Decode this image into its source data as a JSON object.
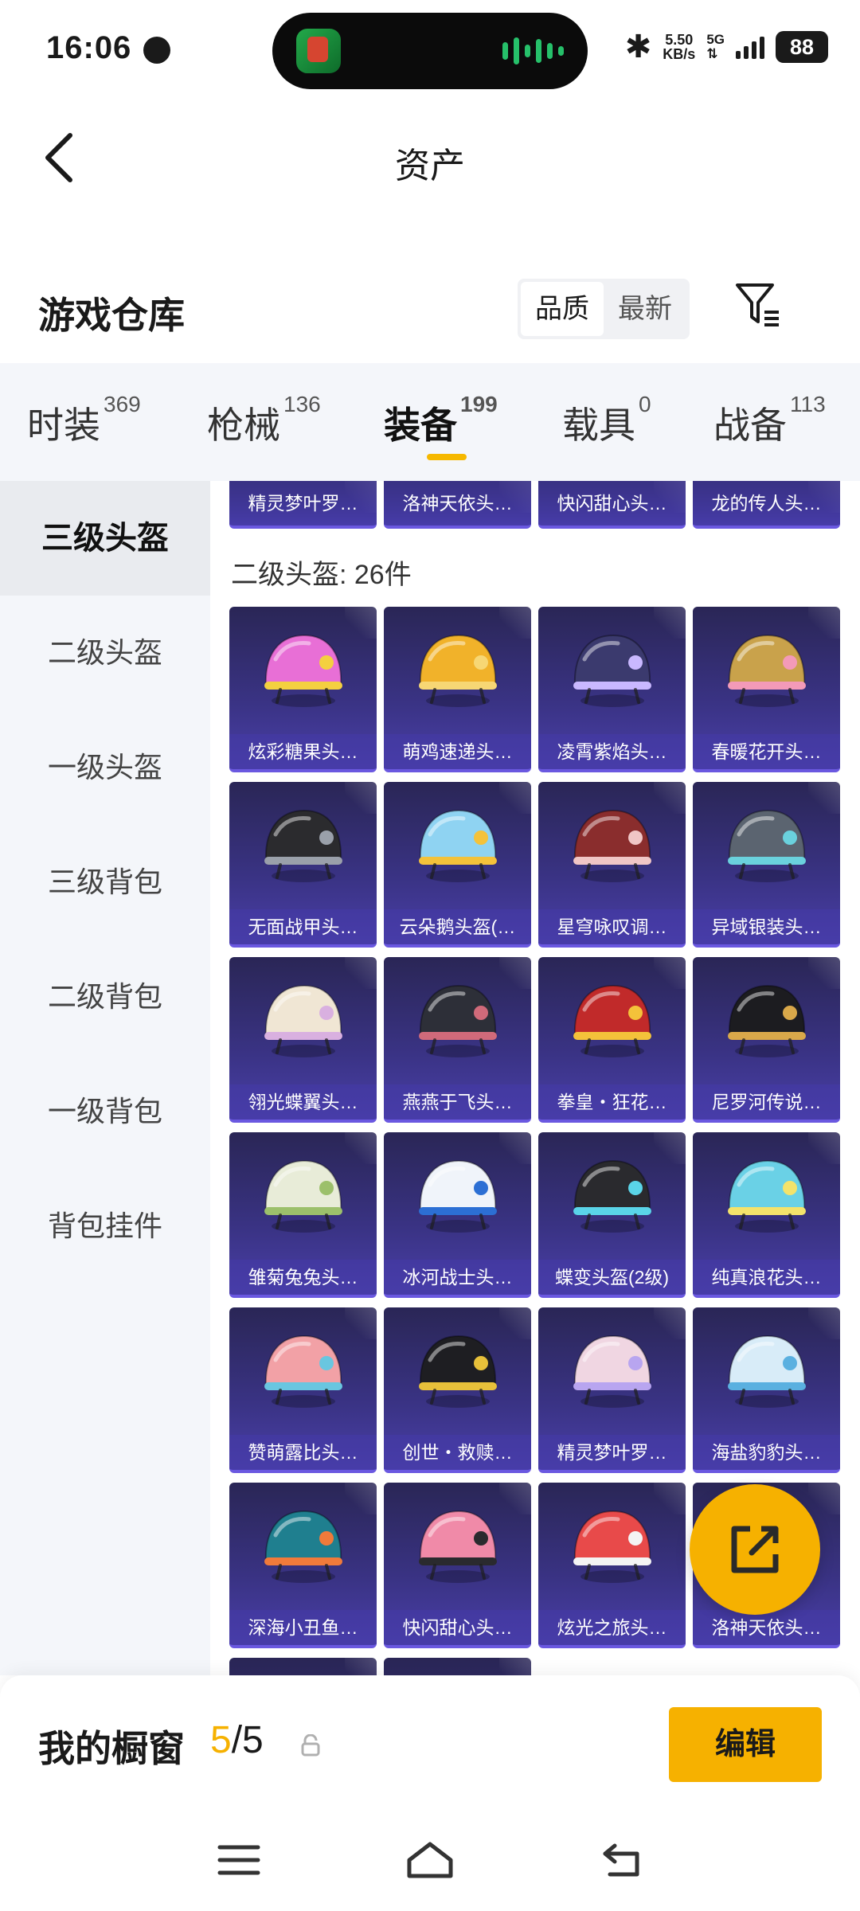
{
  "status_bar": {
    "time": "16:06",
    "net_speed": "5.50",
    "net_unit": "KB/s",
    "network": "5G",
    "battery": "88"
  },
  "header": {
    "title": "资产"
  },
  "section": {
    "title": "游戏仓库",
    "sort_options": [
      "品质",
      "最新"
    ],
    "sort_selected": "品质"
  },
  "tabs": [
    {
      "label": "时装",
      "count": "369"
    },
    {
      "label": "枪械",
      "count": "136"
    },
    {
      "label": "装备",
      "count": "199"
    },
    {
      "label": "载具",
      "count": "0"
    },
    {
      "label": "战备",
      "count": "113"
    }
  ],
  "active_tab": "装备",
  "sidebar": {
    "items": [
      "三级头盔",
      "二级头盔",
      "一级头盔",
      "三级背包",
      "二级背包",
      "一级背包",
      "背包挂件"
    ],
    "active": "三级头盔"
  },
  "top_row": [
    "精灵梦叶罗…",
    "洛神天依头…",
    "快闪甜心头…",
    "龙的传人头…"
  ],
  "group_title": "二级头盔: 26件",
  "items": [
    {
      "label": "炫彩糖果头…",
      "color": "#e86fd6",
      "accent": "#f4d040"
    },
    {
      "label": "萌鸡速递头…",
      "color": "#f1b22a",
      "accent": "#f7d774"
    },
    {
      "label": "凌霄紫焰头…",
      "color": "#3b3a6e",
      "accent": "#c9b8ff"
    },
    {
      "label": "春暖花开头…",
      "color": "#c9a24b",
      "accent": "#f39ab8"
    },
    {
      "label": "无面战甲头…",
      "color": "#2b2b2e",
      "accent": "#9aa0aa"
    },
    {
      "label": "云朵鹅头盔(…",
      "color": "#8fd3f2",
      "accent": "#f4c23a"
    },
    {
      "label": "星穹咏叹调…",
      "color": "#8a2d2d",
      "accent": "#f0c6c6"
    },
    {
      "label": "异域银装头…",
      "color": "#5b6470",
      "accent": "#6ad1dd"
    },
    {
      "label": "翎光蝶翼头…",
      "color": "#f0e6d4",
      "accent": "#d9b0e0"
    },
    {
      "label": "燕燕于飞头…",
      "color": "#2d2f38",
      "accent": "#d06a7a"
    },
    {
      "label": "拳皇・狂花…",
      "color": "#c12a2a",
      "accent": "#f4c23a"
    },
    {
      "label": "尼罗河传说…",
      "color": "#1c1c20",
      "accent": "#d9a84a"
    },
    {
      "label": "雏菊兔兔头…",
      "color": "#e8ecd8",
      "accent": "#9cc06b"
    },
    {
      "label": "冰河战士头…",
      "color": "#f0f4fa",
      "accent": "#2c6fd4"
    },
    {
      "label": "蝶变头盔(2级)",
      "color": "#2a2a2e",
      "accent": "#5ad4e8"
    },
    {
      "label": "纯真浪花头…",
      "color": "#6ad1e6",
      "accent": "#f4e36b"
    },
    {
      "label": "赞萌露比头…",
      "color": "#f2a1a6",
      "accent": "#69c6e0"
    },
    {
      "label": "创世・救赎…",
      "color": "#1e1e22",
      "accent": "#e7c03a"
    },
    {
      "label": "精灵梦叶罗…",
      "color": "#f0d6e2",
      "accent": "#b8a5f0"
    },
    {
      "label": "海盐豹豹头…",
      "color": "#d8ecf8",
      "accent": "#5ab0e0"
    },
    {
      "label": "深海小丑鱼…",
      "color": "#1f7f8f",
      "accent": "#f07a3a"
    },
    {
      "label": "快闪甜心头…",
      "color": "#f08aa8",
      "accent": "#2a2a2e"
    },
    {
      "label": "炫光之旅头…",
      "color": "#e84a4a",
      "accent": "#f4f4f4"
    },
    {
      "label": "洛神天依头…",
      "color": "#bcd4f0",
      "accent": "#8c7ad8"
    }
  ],
  "showcase": {
    "label": "我的橱窗",
    "current": "5",
    "separator": "/",
    "total": "5",
    "edit_label": "编辑"
  },
  "colors": {
    "accent": "#f6b100",
    "card_bg": "#3a3385"
  }
}
